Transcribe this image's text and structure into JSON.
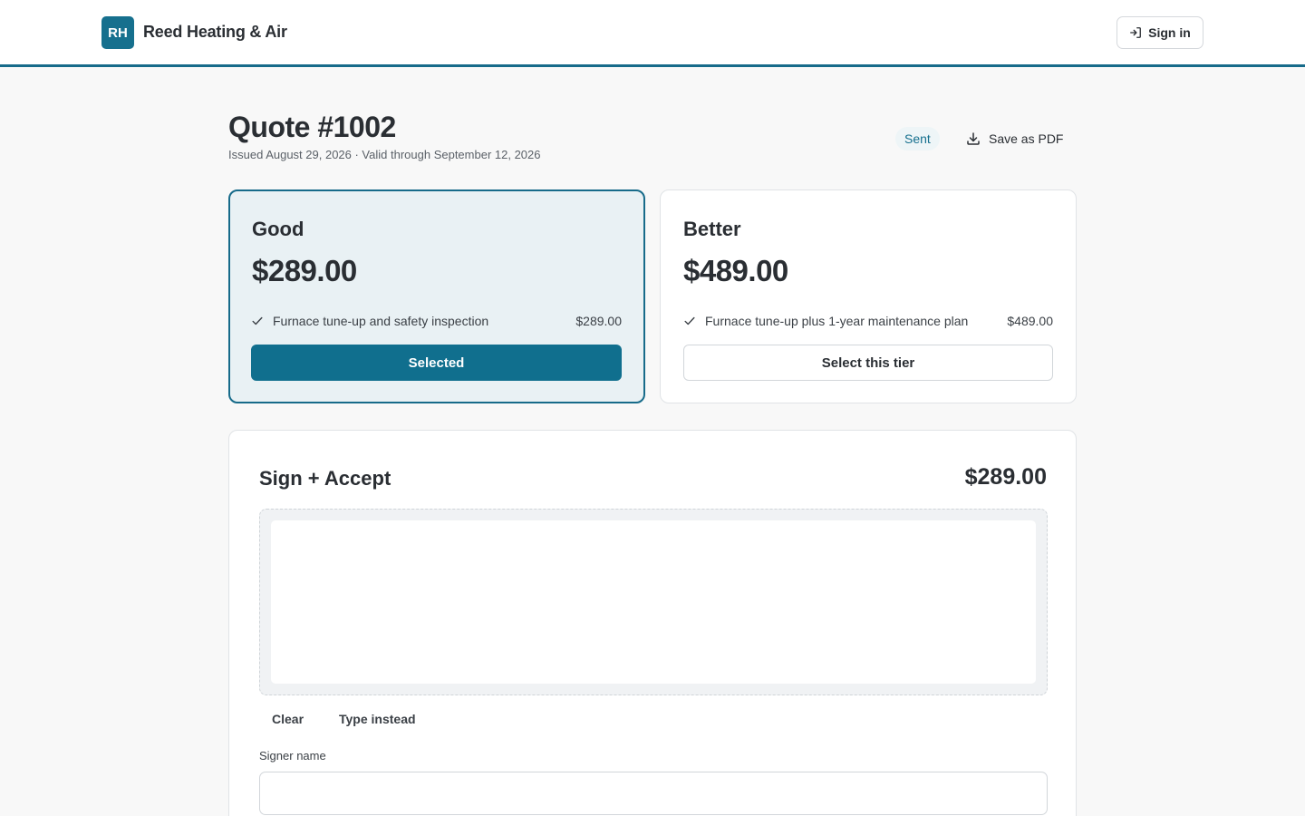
{
  "header": {
    "logo_initials": "RH",
    "brand_name": "Reed Heating & Air",
    "sign_in_label": "Sign in",
    "sign_in_icon": "sign-in-arrow-icon"
  },
  "quote": {
    "title": "Quote #1002",
    "meta": "Issued August 29, 2026 · Valid through September 12, 2026",
    "status": "Sent",
    "save_pdf_label": "Save as PDF",
    "save_pdf_icon": "download-icon"
  },
  "tiers": [
    {
      "name": "Good",
      "price": "$289.00",
      "line_desc": "Furnace tune-up and safety inspection",
      "line_amount": "$289.00",
      "button_label": "Selected",
      "selected": true
    },
    {
      "name": "Better",
      "price": "$489.00",
      "line_desc": "Furnace tune-up plus 1-year maintenance plan",
      "line_amount": "$489.00",
      "button_label": "Select this tier",
      "selected": false
    }
  ],
  "sign": {
    "title": "Sign + Accept",
    "total": "$289.00",
    "clear_label": "Clear",
    "type_instead_label": "Type instead",
    "signer_label": "Signer name",
    "signer_value": ""
  },
  "colors": {
    "accent": "#16708e",
    "selected_bg": "#e9f1f4",
    "page_bg": "#f8f8f8"
  }
}
